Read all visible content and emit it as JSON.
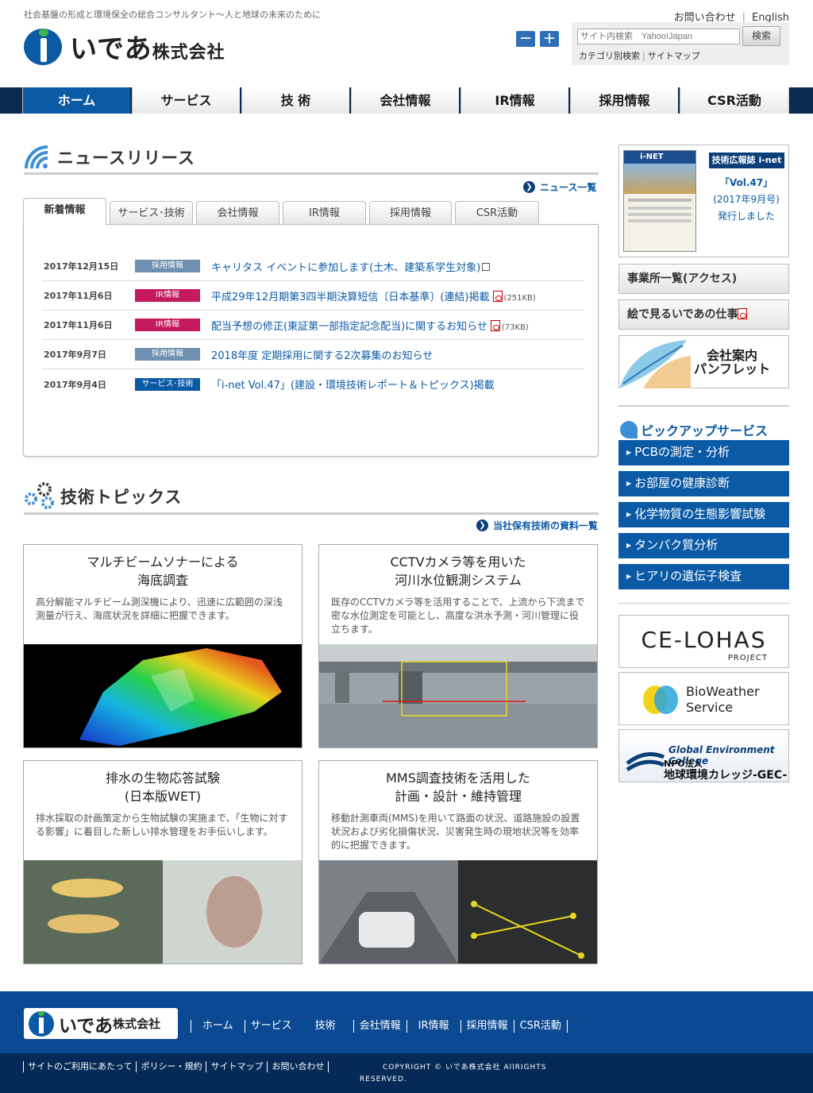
{
  "header": {
    "tagline": "社会基盤の形成と環境保全の総合コンサルタント～人と地球の未来のために",
    "logo_main": "いであ",
    "logo_sub": "株式会社",
    "font_minus": "－",
    "font_plus": "＋",
    "contact": "お問い合わせ",
    "english": "English",
    "search_placeholder": "サイト内検索　Yahoo!Japan",
    "search_button": "検索",
    "category_search": "カテゴリ別検索",
    "sitemap": "サイトマップ"
  },
  "nav": [
    "ホーム",
    "サービス",
    "技 術",
    "会社情報",
    "IR情報",
    "採用情報",
    "CSR活動"
  ],
  "news": {
    "title": "ニュースリリース",
    "more": "ニュース一覧",
    "tabs": [
      "新着情報",
      "サービス･技術",
      "会社情報",
      "IR情報",
      "採用情報",
      "CSR活動"
    ],
    "items": [
      {
        "date": "2017年12月15日",
        "badge": "採用情報",
        "color": "#6f8fae",
        "text": "キャリタス イベントに参加します(土木、建築系学生対象)",
        "size": ""
      },
      {
        "date": "2017年11月6日",
        "badge": "IR情報",
        "color": "#c41b5e",
        "text": "平成29年12月期第3四半期決算短信〔日本基準〕(連結)掲載",
        "size": "(251KB)"
      },
      {
        "date": "2017年11月6日",
        "badge": "IR情報",
        "color": "#c41b5e",
        "text": "配当予想の修正(東証第一部指定記念配当)に関するお知らせ",
        "size": "(73KB)"
      },
      {
        "date": "2017年9月7日",
        "badge": "採用情報",
        "color": "#6f8fae",
        "text": "2018年度 定期採用に関する2次募集のお知らせ",
        "size": ""
      },
      {
        "date": "2017年9月4日",
        "badge": "サービス･技術",
        "color": "#0b5aa6",
        "text": "「i-net Vol.47」(建設・環境技術レポート＆トピックス)掲載",
        "size": ""
      }
    ]
  },
  "topics": {
    "title": "技術トピックス",
    "more": "当社保有技術の資料一覧",
    "items": [
      {
        "title1": "マルチビームソナーによる",
        "title2": "海底調査",
        "desc": "高分解能マルチビーム測深機により、迅速に広範囲の深浅測量が行え、海底状況を詳細に把握できます。"
      },
      {
        "title1": "CCTVカメラ等を用いた",
        "title2": "河川水位観測システム",
        "desc": "既存のCCTVカメラ等を活用することで、上流から下流まで密な水位測定を可能とし、高度な洪水予測・河川管理に役立ちます。"
      },
      {
        "title1": "排水の生物応答試験",
        "title2": "(日本版WET)",
        "desc": "排水採取の計画策定から生物試験の実施まで、「生物に対する影響」に着目した新しい排水管理をお手伝いします。"
      },
      {
        "title1": "MMS調査技術を活用した",
        "title2": "計画・設計・維持管理",
        "desc": "移動計測車両(MMS)を用いて路面の状況、道路施設の設置状況および劣化損傷状況、災害発生時の現地状況等を効率的に把握できます。"
      }
    ]
  },
  "sidebar": {
    "inet_badge": "技術広報誌 i-net",
    "inet_cover": "i-NET",
    "inet_vol": "「Vol.47」",
    "inet_date": "(2017年9月号)",
    "inet_note": "発行しました",
    "offices": "事業所一覧(アクセス)",
    "picture_work": "絵で見るいであの仕事",
    "pamphlet1": "会社案内",
    "pamphlet2": "パンフレット",
    "pickup_title": "ピックアップサービス",
    "pickup": [
      "PCBの測定・分析",
      "お部屋の健康診断",
      "化学物質の生態影響試験",
      "タンパク質分析",
      "ヒアリの遺伝子検査"
    ],
    "celohas": "CE-LOHAS",
    "celohas_sub": "PROJECT",
    "bioweather1": "BioWeather",
    "bioweather2": "Service",
    "gec1": "Global Environment College",
    "gec2": "NPO法人",
    "gec3": "地球環境カレッジ-GEC-"
  },
  "footer": {
    "logo_main": "いであ",
    "logo_sub": "株式会社",
    "links": [
      "ホーム",
      "サービス",
      "技術",
      "会社情報",
      "IR情報",
      "採用情報",
      "CSR活動"
    ],
    "bottom_links": [
      "サイトのご利用にあたって",
      "ポリシー・規約",
      "サイトマップ",
      "お問い合わせ"
    ],
    "copyright1": "COPYRIGHT © いであ株式会社 AllRIGHTS",
    "copyright2": "RESERVED."
  },
  "colors": {
    "brand": "#0b5aa6",
    "nav_bg": "#0b2a50",
    "footer": "#0b4a92",
    "footer_bottom": "#052a57",
    "ir_badge": "#c41b5e",
    "recruit_badge": "#6f8fae"
  }
}
